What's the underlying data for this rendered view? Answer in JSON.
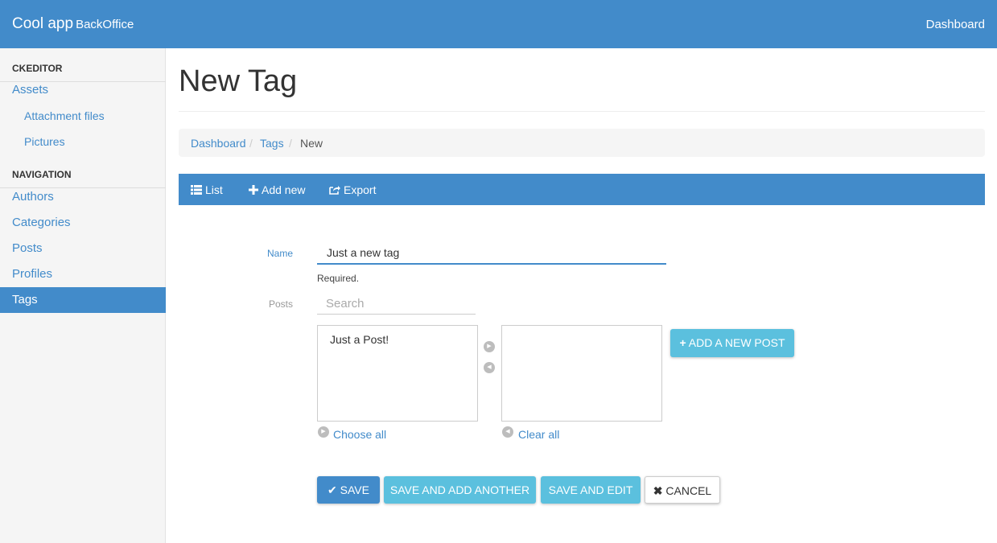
{
  "header": {
    "brand": "Cool app",
    "brand_sub": "BackOffice",
    "dashboard_link": "Dashboard"
  },
  "sidebar": {
    "sections": [
      {
        "title": "CKEDITOR"
      },
      {
        "title": "NAVIGATION"
      }
    ],
    "items": [
      {
        "label": "Assets"
      },
      {
        "label": "Attachment files"
      },
      {
        "label": "Pictures"
      },
      {
        "label": "Authors"
      },
      {
        "label": "Categories"
      },
      {
        "label": "Posts"
      },
      {
        "label": "Profiles"
      },
      {
        "label": "Tags"
      }
    ]
  },
  "page": {
    "title": "New Tag"
  },
  "breadcrumb": {
    "items": [
      "Dashboard",
      "Tags",
      "New"
    ],
    "separator": "/"
  },
  "toolbar": {
    "list": "List",
    "add_new": "Add new",
    "export": "Export"
  },
  "form": {
    "name_label": "Name",
    "name_value": "Just a new tag",
    "name_help": "Required.",
    "posts_label": "Posts",
    "search_placeholder": "Search",
    "available_options": [
      "Just a Post!"
    ],
    "selected_options": [],
    "choose_all": "Choose all",
    "clear_all": "Clear all",
    "add_new_post": "ADD A NEW POST"
  },
  "actions": {
    "save": "SAVE",
    "save_and_add_another": "SAVE AND ADD ANOTHER",
    "save_and_edit": "SAVE AND EDIT",
    "cancel": "CANCEL"
  },
  "colors": {
    "primary": "#428bca",
    "info": "#5bc0de",
    "sidebar_bg": "#f5f5f5"
  }
}
